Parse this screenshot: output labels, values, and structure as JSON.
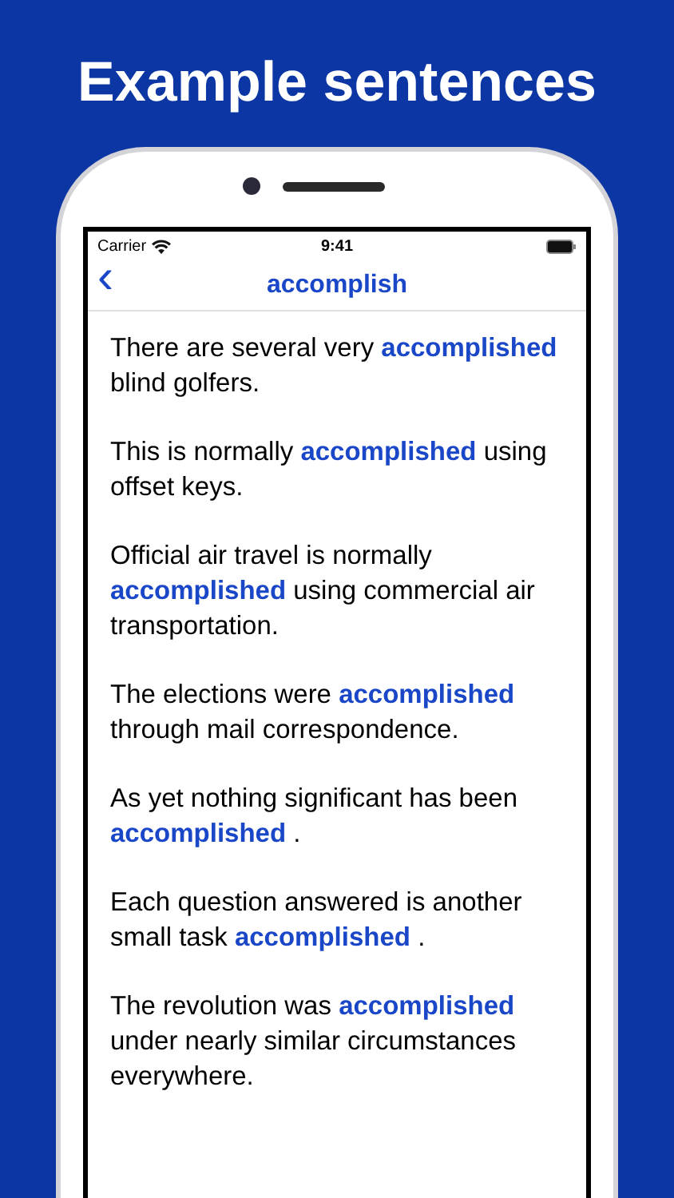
{
  "headline": "Example sentences",
  "status_bar": {
    "carrier": "Carrier",
    "time": "9:41"
  },
  "nav_bar": {
    "back": "‹",
    "title": "accomplish"
  },
  "sentences": [
    "There are several very **accomplished** blind golfers.",
    "This is normally **accomplished** using offset keys.",
    "Official air travel is normally **accomplished** using commercial air transportation.",
    "The elections were **accomplished** through mail correspondence.",
    "As yet nothing significant has been **accomplished** .",
    "Each question answered is another small task **accomplished** .",
    "The revolution was **accomplished** under nearly similar circumstances everywhere."
  ]
}
